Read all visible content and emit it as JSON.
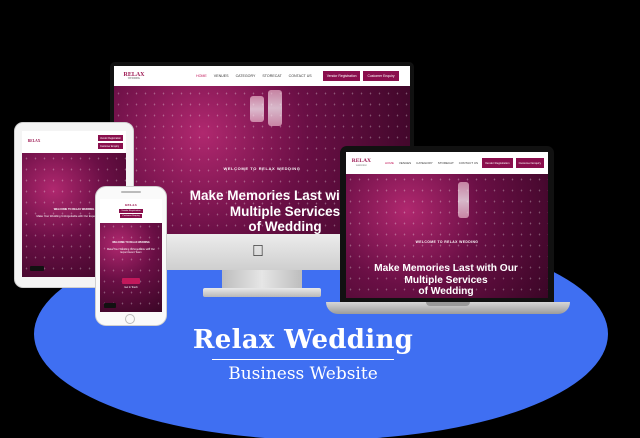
{
  "site": {
    "logo_text": "RELAX",
    "logo_sub": "WEDDING",
    "nav": [
      "HOME",
      "VENUES",
      "CATEGORY",
      "STORECAT",
      "CONTACT US"
    ],
    "btn_primary": "Vendor Registration",
    "btn_secondary": "Customer Enquiry",
    "welcome": "WELCOME TO RELAX WEDDING",
    "hero_line1": "Make Memories Last with Our",
    "hero_line2": "Multiple Services",
    "hero_line3": "of Wedding",
    "mobile_blurb": "Make Your Wedding Unforgettable with Our Expert Event Team",
    "mobile_cta": "Get In Touch"
  },
  "caption": {
    "title": "Relax Wedding",
    "subtitle": "Business Website"
  },
  "colors": {
    "accent_blob": "#3f6ff2",
    "brand": "#9b1550",
    "hero": "#7a1452"
  }
}
